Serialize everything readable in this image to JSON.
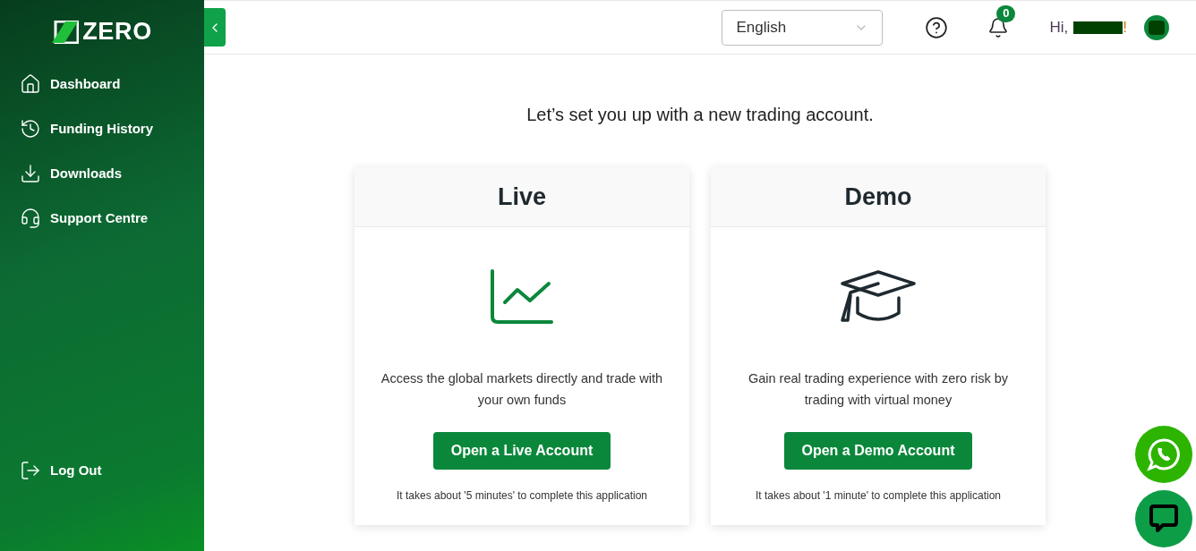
{
  "sidebar": {
    "logo": "ZERO",
    "items": [
      {
        "label": "Dashboard"
      },
      {
        "label": "Funding History"
      },
      {
        "label": "Downloads"
      },
      {
        "label": "Support Centre"
      }
    ],
    "logout": "Log Out"
  },
  "header": {
    "language": "English",
    "notifications": "0",
    "greeting": "Hi,",
    "greeting_end": "!"
  },
  "heading": "Let’s set you up with a new trading account.",
  "cards": [
    {
      "kind": "live",
      "title": "Live",
      "description": "Access the global markets directly and trade with your own funds",
      "button": "Open a Live Account",
      "note": "It takes about '5 minutes' to complete this application"
    },
    {
      "kind": "demo",
      "title": "Demo",
      "description": "Gain real trading experience with zero risk by trading with virtual money",
      "button": "Open a Demo Account",
      "note": "It takes about '1 minute' to complete this application"
    }
  ]
}
